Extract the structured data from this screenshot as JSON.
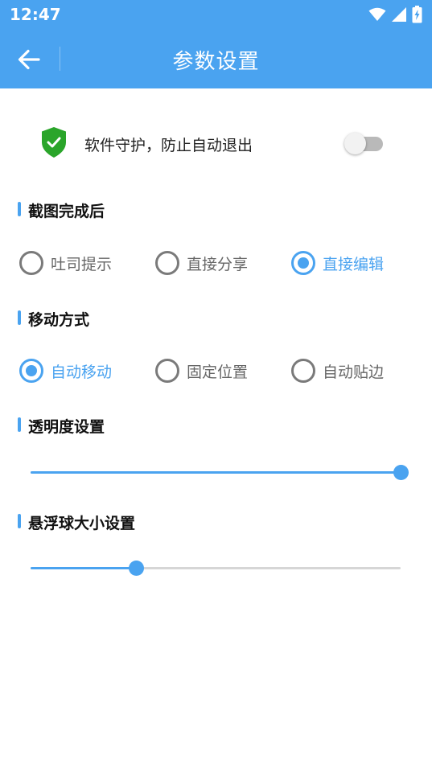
{
  "status_bar": {
    "time": "12:47",
    "icons": [
      "wifi-icon",
      "signal-icon",
      "battery-charging-icon"
    ]
  },
  "toolbar": {
    "back_icon": "arrow-left-icon",
    "title": "参数设置"
  },
  "protect": {
    "icon": "shield-check-icon",
    "label": "软件守护，防止自动退出",
    "enabled": false
  },
  "sections": {
    "screenshot": {
      "title": "截图完成后",
      "options": [
        {
          "label": "吐司提示",
          "checked": false
        },
        {
          "label": "直接分享",
          "checked": false
        },
        {
          "label": "直接编辑",
          "checked": true
        }
      ]
    },
    "move": {
      "title": "移动方式",
      "options": [
        {
          "label": "自动移动",
          "checked": true
        },
        {
          "label": "固定位置",
          "checked": false
        },
        {
          "label": "自动贴边",
          "checked": false
        }
      ]
    },
    "opacity": {
      "title": "透明度设置",
      "value_fraction": 1.0
    },
    "ball_size": {
      "title": "悬浮球大小设置",
      "value_fraction": 0.285
    }
  },
  "colors": {
    "accent": "#4aa3f0",
    "shield": "#2aa52a",
    "toggle_off": "#b9b9b9"
  }
}
